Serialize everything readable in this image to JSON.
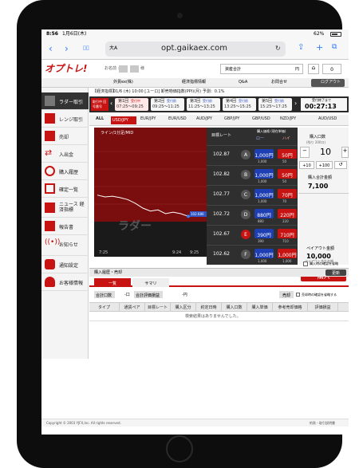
{
  "status": {
    "time": "8:56",
    "date": "1月6日(木)",
    "battery": "62%"
  },
  "safari": {
    "text_size": "大A",
    "url": "opt.gaikaex.com"
  },
  "header": {
    "logo": "オプトレ!",
    "customer_label": "お名前 :",
    "customer_suffix": "様",
    "account_label": "資産合計",
    "account_value": "円",
    "links": [
      "外貨ex(株)",
      "経済指標情報",
      "Q&A",
      "お問合せ",
      "ログアウト"
    ]
  },
  "sidebar": {
    "items": [
      {
        "label": "ラダー取引",
        "icon": "ladder-icon"
      },
      {
        "label": "レンジ取引",
        "icon": "range-icon"
      },
      {
        "label": "売却",
        "icon": "sell-icon"
      },
      {
        "label": "入出金",
        "icon": "transfer-icon"
      },
      {
        "label": "購入履歴",
        "icon": "history-icon"
      },
      {
        "label": "確定一覧",
        "icon": "list-icon"
      },
      {
        "label": "ニュース 経済指標",
        "icon": "news-icon"
      },
      {
        "label": "報告書",
        "icon": "report-icon"
      },
      {
        "label": "お知らせ",
        "icon": "notice-icon"
      },
      {
        "label": "通知設定",
        "icon": "settings-icon"
      },
      {
        "label": "お客様情報",
        "icon": "user-icon"
      }
    ]
  },
  "econ": {
    "label": "【経済指標】",
    "text": "01/6 (木) 10:00 [ユーロ] 卸売物価指数(PPI)(月) 予測：0.1%"
  },
  "timeline": {
    "current": "取引中 回号番号",
    "rounds": [
      {
        "name": "第1回",
        "status": "受付中",
        "time": "07:25〜09:25"
      },
      {
        "name": "第2回",
        "status": "受付前",
        "time": "09:25〜11:25"
      },
      {
        "name": "第3回",
        "status": "受付前",
        "time": "11:25〜13:25"
      },
      {
        "name": "第4回",
        "status": "受付前",
        "time": "13:25〜15:25"
      },
      {
        "name": "第5回",
        "status": "受付前",
        "time": "15:25〜17:25"
      }
    ],
    "deadline_label": "受付終了まで",
    "deadline": "00:27:13"
  },
  "pairs": {
    "items": [
      "ALL",
      "USD/JPY",
      "EUR/JPY",
      "EUR/USD",
      "AUD/JPY",
      "GBP/JPY",
      "GBP/USD",
      "NZD/JPY",
      "AUD/USD"
    ],
    "active": "USD/JPY"
  },
  "chart": {
    "label_top": "ライン/1分足/MID",
    "watermark": "ラダー",
    "x_ticks": [
      "7:25",
      "9:24",
      "9:25"
    ],
    "current_price_badge": "102.680"
  },
  "chart_data": {
    "type": "line",
    "title": "ライン/1分足/MID",
    "xlabel": "",
    "ylabel": "",
    "x": [
      "7:25",
      "7:35",
      "7:45",
      "7:55",
      "8:05",
      "8:15",
      "8:25",
      "8:35",
      "8:45",
      "8:55",
      "9:05",
      "9:15",
      "9:24"
    ],
    "series": [
      {
        "name": "USD/JPY",
        "values": [
          102.74,
          102.735,
          102.737,
          102.733,
          102.728,
          102.718,
          102.705,
          102.697,
          102.7,
          102.69,
          102.694,
          102.69,
          102.683
        ]
      }
    ],
    "ylim": [
      102.6,
      102.9
    ]
  },
  "ladder": {
    "headers": {
      "rate": "目標レート",
      "buy": "購入価格 (現在単価)",
      "low": "ロー",
      "high": "ハイ"
    },
    "rows": [
      {
        "rate": "102.87",
        "letter": "A",
        "low": "1,000",
        "low_sub": "1,000",
        "high": "50",
        "high_sub": "50"
      },
      {
        "rate": "102.82",
        "letter": "B",
        "low": "1,000",
        "low_sub": "1,000",
        "high": "50",
        "high_sub": "50"
      },
      {
        "rate": "102.77",
        "letter": "C",
        "low": "1,000",
        "low_sub": "1,000",
        "high": "70",
        "high_sub": "70"
      },
      {
        "rate": "102.72",
        "letter": "D",
        "low": "880",
        "low_sub": "880",
        "high": "220",
        "high_sub": "220"
      },
      {
        "rate": "102.67",
        "letter": "E",
        "low": "390",
        "low_sub": "390",
        "high": "710",
        "high_sub": "710"
      },
      {
        "rate": "102.62",
        "letter": "F",
        "low": "1,000",
        "low_sub": "1,000",
        "high": "1,000",
        "high_sub": "1,000"
      }
    ],
    "currency": "円"
  },
  "order": {
    "qty_label": "購入口数",
    "qty_sub": "(残り 200口)",
    "qty": "10",
    "plus10": "+10",
    "plus100": "+100",
    "total_label": "購入合計金額",
    "total": "7,100",
    "payout_label": "ペイアウト金額",
    "payout": "10,000",
    "payout_sub": "ペイアウト合計金額",
    "skip_confirm": "購入時の確認を省略",
    "buy": "購入"
  },
  "history": {
    "title": "購入履歴・売却",
    "refresh": "更新",
    "tabs": [
      "一覧",
      "サマリ"
    ],
    "sum_count_label": "合計口数",
    "sum_count": "-口",
    "sum_value_label": "合計評価損益",
    "sum_value": "-円",
    "sell_button": "売却",
    "skip_confirm": "売却時の確認を省略する",
    "columns": [
      "タイプ",
      "通貨ペア",
      "目標レート",
      "購入区分",
      "約定日時",
      "購入口数",
      "購入単価",
      "参考売却価格",
      "評価損益"
    ],
    "empty": "検索結果はありませんでした。"
  },
  "footer": {
    "copyright": "Copyright © 2003 YJFX,Inc. All rights reserved.",
    "link": "約款・取引説明書"
  },
  "colors": {
    "accent": "#c81313",
    "buy_blue": "#1e3fb3"
  }
}
